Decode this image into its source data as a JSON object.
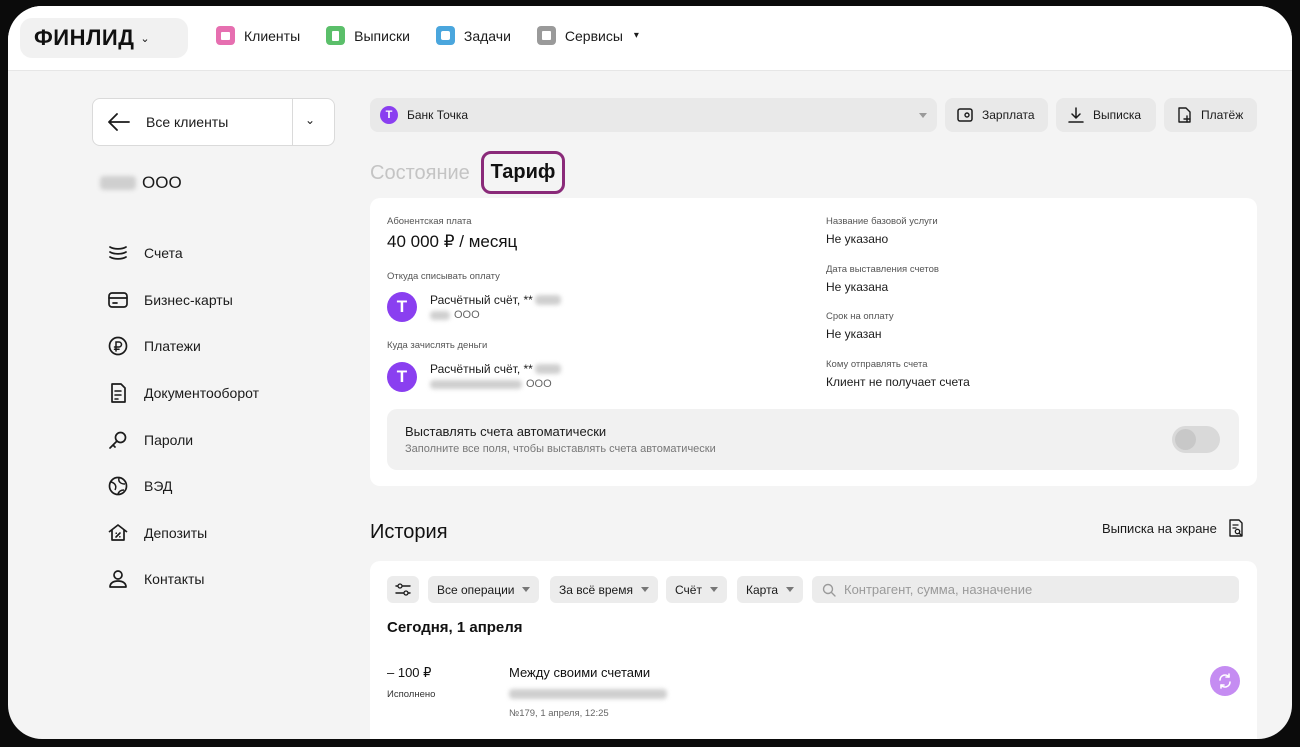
{
  "topnav": {
    "logo": "ФИНЛИД",
    "items": [
      {
        "label": "Клиенты",
        "icon": "briefcase-icon",
        "color": "#e66fb0"
      },
      {
        "label": "Выписки",
        "icon": "document-icon",
        "color": "#5bbf6a"
      },
      {
        "label": "Задачи",
        "icon": "tasks-icon",
        "color": "#4aa6dd"
      },
      {
        "label": "Сервисы",
        "icon": "grid-icon",
        "color": "#9a9a9a"
      }
    ]
  },
  "sidebar": {
    "back_label": "Все клиенты",
    "client_suffix": "ООО",
    "items": [
      {
        "label": "Счета",
        "icon": "accounts-icon"
      },
      {
        "label": "Бизнес-карты",
        "icon": "card-icon"
      },
      {
        "label": "Платежи",
        "icon": "payments-icon"
      },
      {
        "label": "Документооборот",
        "icon": "documents-icon"
      },
      {
        "label": "Пароли",
        "icon": "key-icon"
      },
      {
        "label": "ВЭД",
        "icon": "globe-icon"
      },
      {
        "label": "Депозиты",
        "icon": "deposit-icon"
      },
      {
        "label": "Контакты",
        "icon": "contact-icon"
      }
    ]
  },
  "toolbar": {
    "bank": "Банк Точка",
    "bank_badge": "Т",
    "salary": "Зарплата",
    "statement": "Выписка",
    "payment": "Платёж"
  },
  "tabs": {
    "state": "Состояние",
    "tariff": "Тариф"
  },
  "tariff": {
    "fee_label": "Абонентская плата",
    "fee_value": "40 000 ₽ / месяц",
    "from_label": "Откуда списывать оплату",
    "from_account": "Расчётный счёт, **",
    "from_owner": "ООО",
    "to_label": "Куда зачислять деньги",
    "to_account": "Расчётный счёт, **",
    "to_owner": "ООО",
    "badge": "Т",
    "service_label": "Название базовой услуги",
    "service_value": "Не указано",
    "date_label": "Дата выставления счетов",
    "date_value": "Не указана",
    "term_label": "Срок на оплату",
    "term_value": "Не указан",
    "recipient_label": "Кому отправлять счета",
    "recipient_value": "Клиент не получает счета",
    "auto_title": "Выставлять счета автоматически",
    "auto_hint": "Заполните все поля, чтобы выставлять счета автоматически",
    "auto_enabled": false
  },
  "history": {
    "title": "История",
    "screen_link": "Выписка на экране",
    "filters": {
      "operations": "Все операции",
      "period": "За всё время",
      "account": "Счёт",
      "card": "Карта"
    },
    "search_placeholder": "Контрагент, сумма, назначение",
    "date_heading": "Сегодня, 1 апреля",
    "operation": {
      "amount": "– 100 ₽",
      "status": "Исполнено",
      "title": "Между своими счетами",
      "meta": "№179, 1 апреля, 12:25"
    }
  },
  "colors": {
    "accent": "#8a3ff0",
    "tab_outline": "#8a2a79"
  }
}
